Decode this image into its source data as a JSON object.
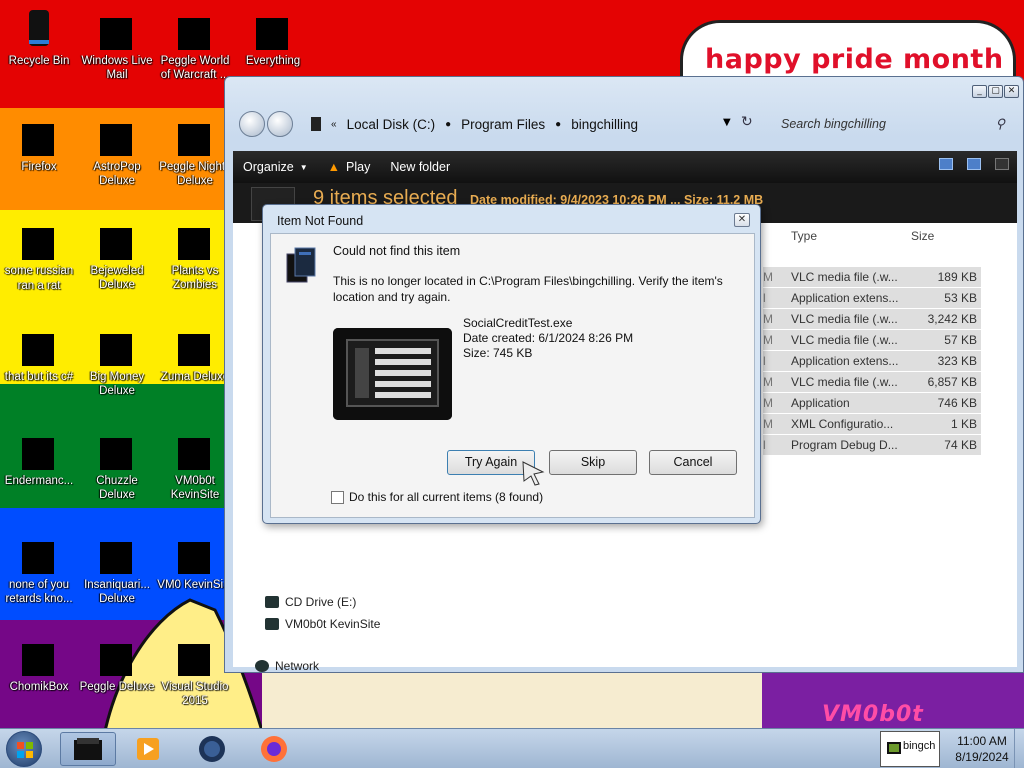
{
  "desktop": {
    "wallpaper_text": "happy pride month",
    "wallpaper_mark": "VM0b0t",
    "stripe_colors": [
      "#e40303",
      "#ff8c00",
      "#ffed00",
      "#008026",
      "#004dff",
      "#750787"
    ],
    "icons": [
      {
        "label": "Recycle Bin",
        "icon": "recycle-bin-icon"
      },
      {
        "label": "Windows Live Mail",
        "icon": "mail-icon"
      },
      {
        "label": "Peggle World of Warcraft ...",
        "icon": "peggle-icon"
      },
      {
        "label": "Everything",
        "icon": "search-app-icon"
      },
      {
        "label": "Firefox",
        "icon": "firefox-icon"
      },
      {
        "label": "AstroPop Deluxe",
        "icon": "astropop-icon"
      },
      {
        "label": "Peggle Nights Deluxe",
        "icon": "peggle-icon"
      },
      {
        "label": "some russian ran a rat",
        "icon": "app-icon"
      },
      {
        "label": "Bejeweled Deluxe",
        "icon": "gem-icon"
      },
      {
        "label": "Plants vs Zombies",
        "icon": "plant-icon"
      },
      {
        "label": "that but its c#",
        "icon": "app-icon"
      },
      {
        "label": "Big Money Deluxe",
        "icon": "money-icon"
      },
      {
        "label": "Zuma Deluxe",
        "icon": "zuma-icon"
      },
      {
        "label": "Endermanc...",
        "icon": "app-icon"
      },
      {
        "label": "Chuzzle Deluxe",
        "icon": "chuzzle-icon"
      },
      {
        "label": "VM0b0t KevinSite",
        "icon": "app-icon"
      },
      {
        "label": "none of you retards kno...",
        "icon": "app-icon"
      },
      {
        "label": "Insaniquari... Deluxe",
        "icon": "fish-icon"
      },
      {
        "label": "VM0 KevinSi...",
        "icon": "app-icon"
      },
      {
        "label": "ChomikBox",
        "icon": "hamster-icon"
      },
      {
        "label": "Peggle Deluxe",
        "icon": "peggle-icon"
      },
      {
        "label": "Visual Studio 2015",
        "icon": "visual-studio-icon"
      }
    ]
  },
  "explorer": {
    "breadcrumb": [
      "Local Disk (C:)",
      "Program Files",
      "bingchilling"
    ],
    "search_placeholder": "Search bingchilling",
    "toolbar": {
      "organize": "Organize",
      "play": "Play",
      "new_folder": "New folder"
    },
    "details": {
      "count": "9 items selected",
      "meta": "Date modified: 9/4/2023 10:26 PM ... Size: 11.2 MB"
    },
    "columns": {
      "type": "Type",
      "size": "Size"
    },
    "files": [
      {
        "type": "VLC media file (.w...",
        "size": "189 KB"
      },
      {
        "type": "Application extens...",
        "size": "53 KB"
      },
      {
        "type": "VLC media file (.w...",
        "size": "3,242 KB"
      },
      {
        "type": "VLC media file (.w...",
        "size": "57 KB"
      },
      {
        "type": "Application extens...",
        "size": "323 KB"
      },
      {
        "type": "VLC media file (.w...",
        "size": "6,857 KB"
      },
      {
        "type": "Application",
        "size": "746 KB"
      },
      {
        "type": "XML Configuratio...",
        "size": "1 KB"
      },
      {
        "type": "Program Debug D...",
        "size": "74 KB"
      }
    ],
    "nav": {
      "cd_drive": "CD Drive (E:)",
      "vm": "VM0b0t KevinSite",
      "network": "Network"
    }
  },
  "dialog": {
    "title": "Item Not Found",
    "heading": "Could not find this item",
    "message": "This is no longer located in C:\\Program Files\\bingchilling. Verify the item's location and try again.",
    "file_name": "SocialCreditTest.exe",
    "file_date": "Date created: 6/1/2024 8:26 PM",
    "file_size": "Size: 745 KB",
    "buttons": {
      "try_again": "Try Again",
      "skip": "Skip",
      "cancel": "Cancel"
    },
    "checkbox_label": "Do this for all current items (8 found)"
  },
  "taskbar": {
    "tray_text": "bingch",
    "time": "11:00 AM",
    "date": "8/19/2024"
  }
}
